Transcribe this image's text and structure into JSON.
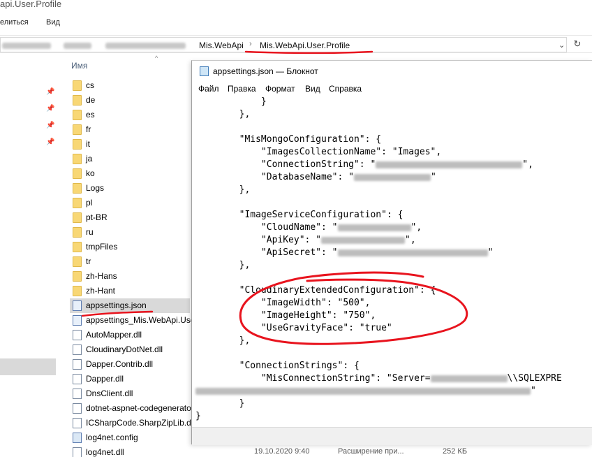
{
  "explorer": {
    "title": "api.User.Profile",
    "ribbon_tabs": [
      "елиться",
      "Вид"
    ],
    "breadcrumb": [
      "Mis.WebApi",
      "Mis.WebApi.User.Profile"
    ],
    "column_header": "Имя",
    "files": [
      {
        "name": "cs",
        "type": "folder"
      },
      {
        "name": "de",
        "type": "folder"
      },
      {
        "name": "es",
        "type": "folder"
      },
      {
        "name": "fr",
        "type": "folder"
      },
      {
        "name": "it",
        "type": "folder"
      },
      {
        "name": "ja",
        "type": "folder"
      },
      {
        "name": "ko",
        "type": "folder"
      },
      {
        "name": "Logs",
        "type": "folder"
      },
      {
        "name": "pl",
        "type": "folder"
      },
      {
        "name": "pt-BR",
        "type": "folder"
      },
      {
        "name": "ru",
        "type": "folder"
      },
      {
        "name": "tmpFiles",
        "type": "folder"
      },
      {
        "name": "tr",
        "type": "folder"
      },
      {
        "name": "zh-Hans",
        "type": "folder"
      },
      {
        "name": "zh-Hant",
        "type": "folder"
      },
      {
        "name": "appsettings.json",
        "type": "json",
        "selected": true
      },
      {
        "name": "appsettings_Mis.WebApi.User",
        "type": "json"
      },
      {
        "name": "AutoMapper.dll",
        "type": "file"
      },
      {
        "name": "CloudinaryDotNet.dll",
        "type": "file"
      },
      {
        "name": "Dapper.Contrib.dll",
        "type": "file"
      },
      {
        "name": "Dapper.dll",
        "type": "file"
      },
      {
        "name": "DnsClient.dll",
        "type": "file"
      },
      {
        "name": "dotnet-aspnet-codegenerato",
        "type": "file"
      },
      {
        "name": "ICSharpCode.SharpZipLib.dll",
        "type": "file"
      },
      {
        "name": "log4net.config",
        "type": "config"
      },
      {
        "name": "log4net.dll",
        "type": "file"
      }
    ],
    "bottom_row": {
      "date": "19.10.2020 9:40",
      "type": "Расширение при...",
      "size": "252 КБ"
    }
  },
  "notepad": {
    "title": "appsettings.json — Блокнот",
    "menu": [
      "Файл",
      "Правка",
      "Формат",
      "Вид",
      "Справка"
    ],
    "lines": [
      {
        "text": "            }"
      },
      {
        "text": "        },"
      },
      {
        "text": ""
      },
      {
        "text": "        \"MisMongoConfiguration\": {"
      },
      {
        "text": "            \"ImagesCollectionName\": \"Images\","
      },
      {
        "text": "            \"ConnectionString\": \"",
        "blur": 210,
        "after": "\","
      },
      {
        "text": "            \"DatabaseName\": \"",
        "blur": 110,
        "after": "\""
      },
      {
        "text": "        },"
      },
      {
        "text": ""
      },
      {
        "text": "        \"ImageServiceConfiguration\": {"
      },
      {
        "text": "            \"CloudName\": \"",
        "blur": 105,
        "after": "\","
      },
      {
        "text": "            \"ApiKey\": \"",
        "blur": 120,
        "after": "\","
      },
      {
        "text": "            \"ApiSecret\": \"",
        "blur": 215,
        "after": "\""
      },
      {
        "text": "        },"
      },
      {
        "text": ""
      },
      {
        "text": "        \"CloudinaryExtendedConfiguration\": {"
      },
      {
        "text": "            \"ImageWidth\": \"500\","
      },
      {
        "text": "            \"ImageHeight\": \"750\","
      },
      {
        "text": "            \"UseGravityFace\": \"true\""
      },
      {
        "text": "        },"
      },
      {
        "text": ""
      },
      {
        "text": "        \"ConnectionStrings\": {"
      },
      {
        "text": "            \"MisConnectionString\": \"Server=",
        "blur": 110,
        "after": "\\\\SQLEXPRE"
      },
      {
        "text": "",
        "blur": 480,
        "after": "\""
      },
      {
        "text": "        }"
      },
      {
        "text": "}"
      }
    ]
  },
  "colors": {
    "annotation": "#e8141e",
    "folder": "#f8d775",
    "selection": "#d9d9d9"
  }
}
